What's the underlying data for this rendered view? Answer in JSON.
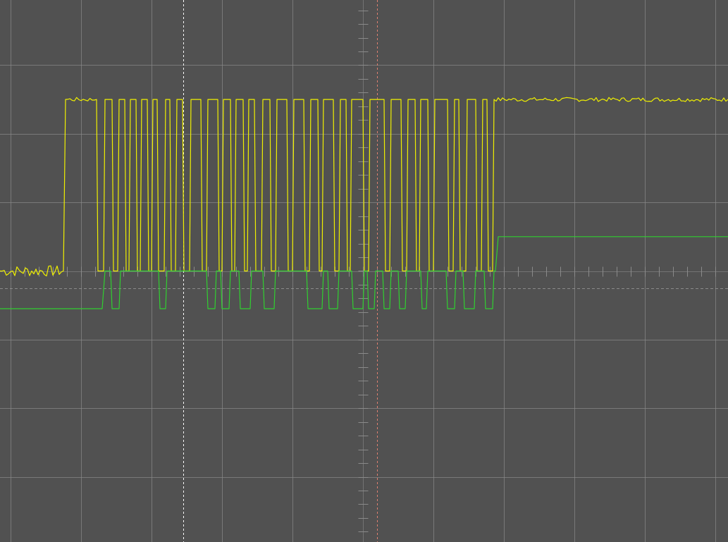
{
  "chart_data": {
    "type": "line",
    "title": "",
    "xlabel": "",
    "ylabel": "",
    "xlim": [
      -5.15,
      5.18
    ],
    "ylim": [
      -3.95,
      3.95
    ],
    "grid": true,
    "grid_color": "#8a8a8a",
    "background_color": "#515151",
    "x_divisions": 10,
    "y_divisions": 8,
    "cursors": [
      {
        "name": "cursor-a",
        "x": -2.55,
        "color": "#ffffff",
        "style": "dashed"
      },
      {
        "name": "cursor-b",
        "x": 0.2,
        "color": "#e08070",
        "style": "dashed"
      }
    ],
    "trigger_level": -0.25,
    "series": [
      {
        "color": "#f0f000",
        "noise": 0.05,
        "points": [
          [
            -5.15,
            0.0
          ],
          [
            -4.25,
            0.0
          ],
          [
            -4.22,
            2.5
          ],
          [
            -3.78,
            2.5
          ],
          [
            -3.76,
            0.0
          ],
          [
            -3.68,
            0.0
          ],
          [
            -3.66,
            2.5
          ],
          [
            -3.56,
            2.5
          ],
          [
            -3.54,
            0.0
          ],
          [
            -3.48,
            0.0
          ],
          [
            -3.46,
            2.5
          ],
          [
            -3.38,
            2.5
          ],
          [
            -3.36,
            0.0
          ],
          [
            -3.32,
            0.0
          ],
          [
            -3.3,
            2.5
          ],
          [
            -3.22,
            2.5
          ],
          [
            -3.2,
            0.0
          ],
          [
            -3.16,
            0.0
          ],
          [
            -3.14,
            2.5
          ],
          [
            -3.06,
            2.5
          ],
          [
            -3.04,
            0.0
          ],
          [
            -3.0,
            0.0
          ],
          [
            -2.98,
            2.5
          ],
          [
            -2.92,
            2.5
          ],
          [
            -2.9,
            0.0
          ],
          [
            -2.82,
            0.0
          ],
          [
            -2.8,
            2.5
          ],
          [
            -2.74,
            2.5
          ],
          [
            -2.72,
            0.0
          ],
          [
            -2.66,
            0.0
          ],
          [
            -2.64,
            2.5
          ],
          [
            -2.56,
            2.5
          ],
          [
            -2.54,
            0.0
          ],
          [
            -2.46,
            0.0
          ],
          [
            -2.44,
            2.5
          ],
          [
            -2.3,
            2.5
          ],
          [
            -2.28,
            0.0
          ],
          [
            -2.22,
            0.0
          ],
          [
            -2.2,
            2.5
          ],
          [
            -2.06,
            2.5
          ],
          [
            -2.04,
            0.0
          ],
          [
            -2.0,
            0.0
          ],
          [
            -1.98,
            2.5
          ],
          [
            -1.88,
            2.5
          ],
          [
            -1.86,
            0.0
          ],
          [
            -1.82,
            0.0
          ],
          [
            -1.8,
            2.5
          ],
          [
            -1.7,
            2.5
          ],
          [
            -1.68,
            0.0
          ],
          [
            -1.64,
            0.0
          ],
          [
            -1.62,
            2.5
          ],
          [
            -1.54,
            2.5
          ],
          [
            -1.52,
            0.0
          ],
          [
            -1.44,
            0.0
          ],
          [
            -1.42,
            2.5
          ],
          [
            -1.32,
            2.5
          ],
          [
            -1.3,
            0.0
          ],
          [
            -1.24,
            0.0
          ],
          [
            -1.22,
            2.5
          ],
          [
            -1.08,
            2.5
          ],
          [
            -1.06,
            0.0
          ],
          [
            -1.0,
            0.0
          ],
          [
            -0.98,
            2.5
          ],
          [
            -0.84,
            2.5
          ],
          [
            -0.82,
            0.0
          ],
          [
            -0.76,
            0.0
          ],
          [
            -0.74,
            2.5
          ],
          [
            -0.64,
            2.5
          ],
          [
            -0.62,
            0.0
          ],
          [
            -0.58,
            0.0
          ],
          [
            -0.56,
            2.5
          ],
          [
            -0.42,
            2.5
          ],
          [
            -0.4,
            0.0
          ],
          [
            -0.34,
            0.0
          ],
          [
            -0.32,
            2.5
          ],
          [
            -0.24,
            2.5
          ],
          [
            -0.22,
            0.0
          ],
          [
            -0.18,
            0.0
          ],
          [
            -0.16,
            2.5
          ],
          [
            0.0,
            2.5
          ],
          [
            0.02,
            0.0
          ],
          [
            0.08,
            0.0
          ],
          [
            0.1,
            2.5
          ],
          [
            0.3,
            2.5
          ],
          [
            0.32,
            0.0
          ],
          [
            0.38,
            0.0
          ],
          [
            0.4,
            2.5
          ],
          [
            0.54,
            2.5
          ],
          [
            0.56,
            0.0
          ],
          [
            0.62,
            0.0
          ],
          [
            0.64,
            2.5
          ],
          [
            0.74,
            2.5
          ],
          [
            0.76,
            0.0
          ],
          [
            0.8,
            0.0
          ],
          [
            0.82,
            2.5
          ],
          [
            0.92,
            2.5
          ],
          [
            0.94,
            0.0
          ],
          [
            1.0,
            0.0
          ],
          [
            1.02,
            2.5
          ],
          [
            1.2,
            2.5
          ],
          [
            1.22,
            0.0
          ],
          [
            1.28,
            0.0
          ],
          [
            1.3,
            2.5
          ],
          [
            1.36,
            2.5
          ],
          [
            1.38,
            0.0
          ],
          [
            1.46,
            0.0
          ],
          [
            1.48,
            2.5
          ],
          [
            1.6,
            2.5
          ],
          [
            1.62,
            0.0
          ],
          [
            1.68,
            0.0
          ],
          [
            1.7,
            2.5
          ],
          [
            1.76,
            2.5
          ],
          [
            1.78,
            0.0
          ],
          [
            1.84,
            0.0
          ],
          [
            1.86,
            2.5
          ],
          [
            5.18,
            2.5
          ]
        ]
      },
      {
        "color": "#30d030",
        "noise": 0.0,
        "points": [
          [
            -5.15,
            -0.55
          ],
          [
            -3.7,
            -0.55
          ],
          [
            -3.66,
            0.0
          ],
          [
            -3.58,
            0.0
          ],
          [
            -3.56,
            -0.55
          ],
          [
            -3.46,
            -0.55
          ],
          [
            -3.44,
            0.0
          ],
          [
            -2.9,
            0.0
          ],
          [
            -2.88,
            -0.55
          ],
          [
            -2.8,
            -0.55
          ],
          [
            -2.78,
            0.0
          ],
          [
            -2.22,
            0.0
          ],
          [
            -2.2,
            -0.55
          ],
          [
            -2.1,
            -0.55
          ],
          [
            -2.08,
            0.0
          ],
          [
            -2.02,
            0.0
          ],
          [
            -2.0,
            -0.55
          ],
          [
            -1.9,
            -0.55
          ],
          [
            -1.88,
            0.0
          ],
          [
            -1.76,
            0.0
          ],
          [
            -1.74,
            -0.55
          ],
          [
            -1.6,
            -0.55
          ],
          [
            -1.58,
            0.0
          ],
          [
            -1.42,
            0.0
          ],
          [
            -1.4,
            -0.55
          ],
          [
            -1.26,
            -0.55
          ],
          [
            -1.24,
            0.0
          ],
          [
            -0.8,
            0.0
          ],
          [
            -0.78,
            -0.55
          ],
          [
            -0.58,
            -0.55
          ],
          [
            -0.56,
            0.0
          ],
          [
            -0.5,
            0.0
          ],
          [
            -0.48,
            -0.55
          ],
          [
            -0.36,
            -0.55
          ],
          [
            -0.34,
            0.0
          ],
          [
            -0.16,
            0.0
          ],
          [
            -0.14,
            -0.55
          ],
          [
            0.0,
            -0.55
          ],
          [
            0.02,
            0.0
          ],
          [
            0.06,
            0.0
          ],
          [
            0.08,
            -0.55
          ],
          [
            0.16,
            -0.55
          ],
          [
            0.18,
            0.0
          ],
          [
            0.28,
            0.0
          ],
          [
            0.3,
            -0.55
          ],
          [
            0.38,
            -0.55
          ],
          [
            0.4,
            0.0
          ],
          [
            0.5,
            0.0
          ],
          [
            0.52,
            -0.55
          ],
          [
            0.6,
            -0.55
          ],
          [
            0.62,
            0.0
          ],
          [
            0.82,
            0.0
          ],
          [
            0.84,
            -0.55
          ],
          [
            0.9,
            -0.55
          ],
          [
            0.92,
            0.0
          ],
          [
            1.18,
            0.0
          ],
          [
            1.2,
            -0.55
          ],
          [
            1.3,
            -0.55
          ],
          [
            1.32,
            0.0
          ],
          [
            1.42,
            0.0
          ],
          [
            1.44,
            -0.55
          ],
          [
            1.58,
            -0.55
          ],
          [
            1.6,
            0.0
          ],
          [
            1.72,
            0.0
          ],
          [
            1.74,
            -0.55
          ],
          [
            1.84,
            -0.55
          ],
          [
            1.86,
            0.0
          ],
          [
            1.88,
            0.0
          ],
          [
            1.92,
            0.5
          ],
          [
            5.18,
            0.5
          ]
        ]
      }
    ]
  }
}
